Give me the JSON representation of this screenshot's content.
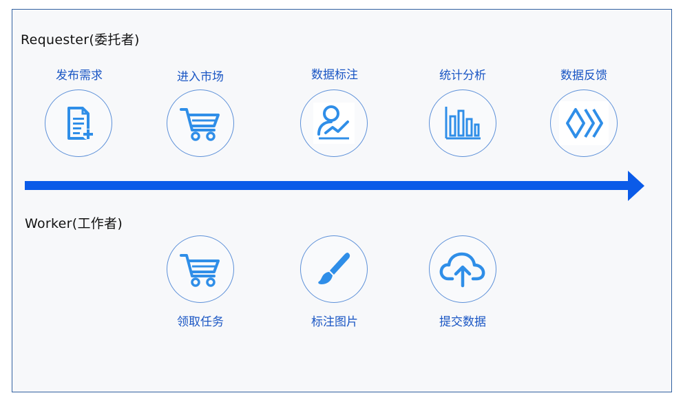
{
  "requester": {
    "title": "Requester(委托者)",
    "steps": [
      {
        "label": "发布需求",
        "icon": "document-add-icon"
      },
      {
        "label": "进入市场",
        "icon": "shopping-cart-icon"
      },
      {
        "label": "数据标注",
        "icon": "user-chart-icon"
      },
      {
        "label": "统计分析",
        "icon": "bar-chart-icon"
      },
      {
        "label": "数据反馈",
        "icon": "feedback-chevrons-icon"
      }
    ]
  },
  "worker": {
    "title": "Worker(工作者)",
    "steps": [
      {
        "label": "领取任务",
        "icon": "shopping-cart-icon"
      },
      {
        "label": "标注图片",
        "icon": "paintbrush-icon"
      },
      {
        "label": "提交数据",
        "icon": "cloud-upload-icon"
      }
    ]
  },
  "colors": {
    "icon": "#2f8ee8",
    "arrow": "#0b5be8",
    "label": "#1a56c4",
    "circle_border": "#5b8fd8"
  }
}
